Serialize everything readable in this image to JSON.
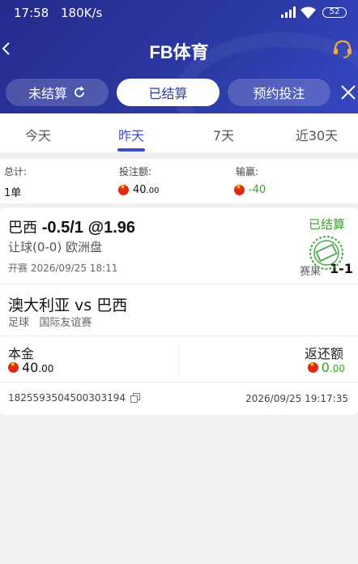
{
  "status_bar": {
    "time": "17:58",
    "speed": "180K/s",
    "battery": "52"
  },
  "header": {
    "title": "FB体育"
  },
  "tabs": [
    {
      "label": "未结算"
    },
    {
      "label": "已结算"
    },
    {
      "label": "预约投注"
    }
  ],
  "date_tabs": [
    {
      "label": "今天"
    },
    {
      "label": "昨天",
      "active": true
    },
    {
      "label": "7天"
    },
    {
      "label": "近30天"
    }
  ],
  "summary": {
    "total_label": "总计:",
    "total_value": "1单",
    "stake_label": "投注额:",
    "stake_int": "40",
    "stake_dec": ".00",
    "win_label": "输赢:",
    "win_value": "-40"
  },
  "bet": {
    "team": "巴西",
    "line": "-0.5/1",
    "odds": "@1.96",
    "status": "已结算",
    "market": "让球(0-0) 欧洲盘",
    "kickoff": "开赛 2026/09/25 18:11",
    "result_label": "赛果",
    "result_score": "1-1",
    "match": "澳大利亚 vs 巴西",
    "sport": "足球",
    "league": "国际友谊赛",
    "principal_label": "本金",
    "principal_int": "40",
    "principal_dec": ".00",
    "return_label": "返还额",
    "return_int": "0",
    "return_dec": ".00",
    "order_no": "1825593504500303194",
    "order_time": "2026/09/25 19:17:35"
  },
  "colors": {
    "accent": "#3b50c8",
    "header": "#2d3aa6",
    "green": "#3aa12c"
  }
}
